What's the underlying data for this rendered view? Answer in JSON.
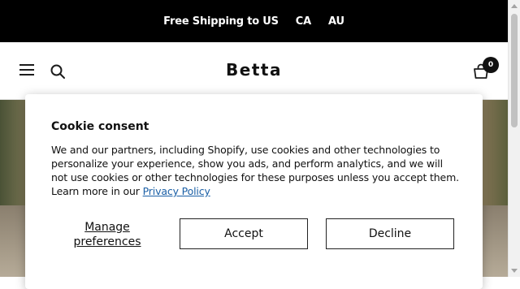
{
  "announcement": {
    "shipping_text": "Free Shipping to US",
    "ca_label": "CA",
    "au_label": "AU"
  },
  "header": {
    "logo": "Betta",
    "cart_count": "0",
    "icons": [
      "menu-icon",
      "search-icon",
      "cart-icon"
    ]
  },
  "cookie_modal": {
    "title": "Cookie consent",
    "body": "We and our partners, including Shopify, use cookies and other technologies to personalize your experience, show you ads, and perform analytics, and we will not use cookies or other technologies for these purposes unless you accept them. Learn more in our",
    "policy_link": "Privacy Policy",
    "manage_label": "Manage preferences",
    "accept_label": "Accept",
    "decline_label": "Decline"
  },
  "colors": {
    "announcement_bg": "#000000",
    "link": "#1a5fa6"
  }
}
